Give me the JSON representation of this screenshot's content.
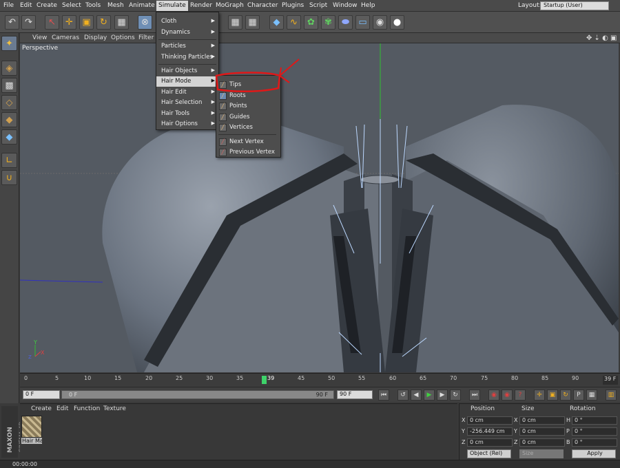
{
  "menubar": {
    "items": [
      "File",
      "Edit",
      "Create",
      "Select",
      "Tools",
      "Mesh",
      "Animate",
      "Simulate",
      "Render",
      "MoGraph",
      "Character",
      "Plugins",
      "Script",
      "Window",
      "Help"
    ],
    "active": "Simulate",
    "layout_label": "Layout:",
    "layout_value": "Startup (User)"
  },
  "viewport_menu": [
    "View",
    "Cameras",
    "Display",
    "Options",
    "Filter"
  ],
  "viewport_label": "Perspective",
  "simulate_menu": {
    "items": [
      "Cloth",
      "Dynamics",
      "Particles",
      "Thinking Particles",
      "Hair Objects",
      "Hair Mode",
      "Hair Edit",
      "Hair Selection",
      "Hair Tools",
      "Hair Options"
    ],
    "highlighted": "Hair Mode"
  },
  "hair_mode_submenu": {
    "items": [
      "Tips",
      "Roots",
      "Points",
      "Guides",
      "Vertices",
      "Next Vertex",
      "Previous Vertex"
    ]
  },
  "timeline": {
    "ticks": [
      "0",
      "5",
      "10",
      "15",
      "20",
      "25",
      "30",
      "35",
      "39",
      "45",
      "50",
      "55",
      "60",
      "65",
      "70",
      "75",
      "80",
      "85",
      "90"
    ],
    "current_frame": "39 F"
  },
  "transport": {
    "start_field": "0 F",
    "range_start": "0 F",
    "range_end": "90 F",
    "end_field": "90 F"
  },
  "material_panel": {
    "menu": [
      "Create",
      "Edit",
      "Function",
      "Texture"
    ],
    "material_name": "Hair Ma"
  },
  "coordinates": {
    "headers": [
      "Position",
      "Size",
      "Rotation"
    ],
    "rows": [
      {
        "pos_axis": "X",
        "pos": "0 cm",
        "size_axis": "X",
        "size": "0 cm",
        "rot_axis": "H",
        "rot": "0 °"
      },
      {
        "pos_axis": "Y",
        "pos": "-256.449 cm",
        "size_axis": "Y",
        "size": "0 cm",
        "rot_axis": "P",
        "rot": "0 °"
      },
      {
        "pos_axis": "Z",
        "pos": "0 cm",
        "size_axis": "Z",
        "size": "0 cm",
        "rot_axis": "B",
        "rot": "0 °"
      }
    ],
    "mode": "Object (Rel)",
    "size_mode": "Size",
    "apply_label": "Apply"
  },
  "status": {
    "time": "00:00:00"
  },
  "brand": {
    "maxon": "MAXON",
    "cinema": "CINEMA 4D"
  },
  "colors": {
    "annotation_red": "#e01818",
    "highlight": "#d4d4d4",
    "playhead": "#3ed36a"
  }
}
